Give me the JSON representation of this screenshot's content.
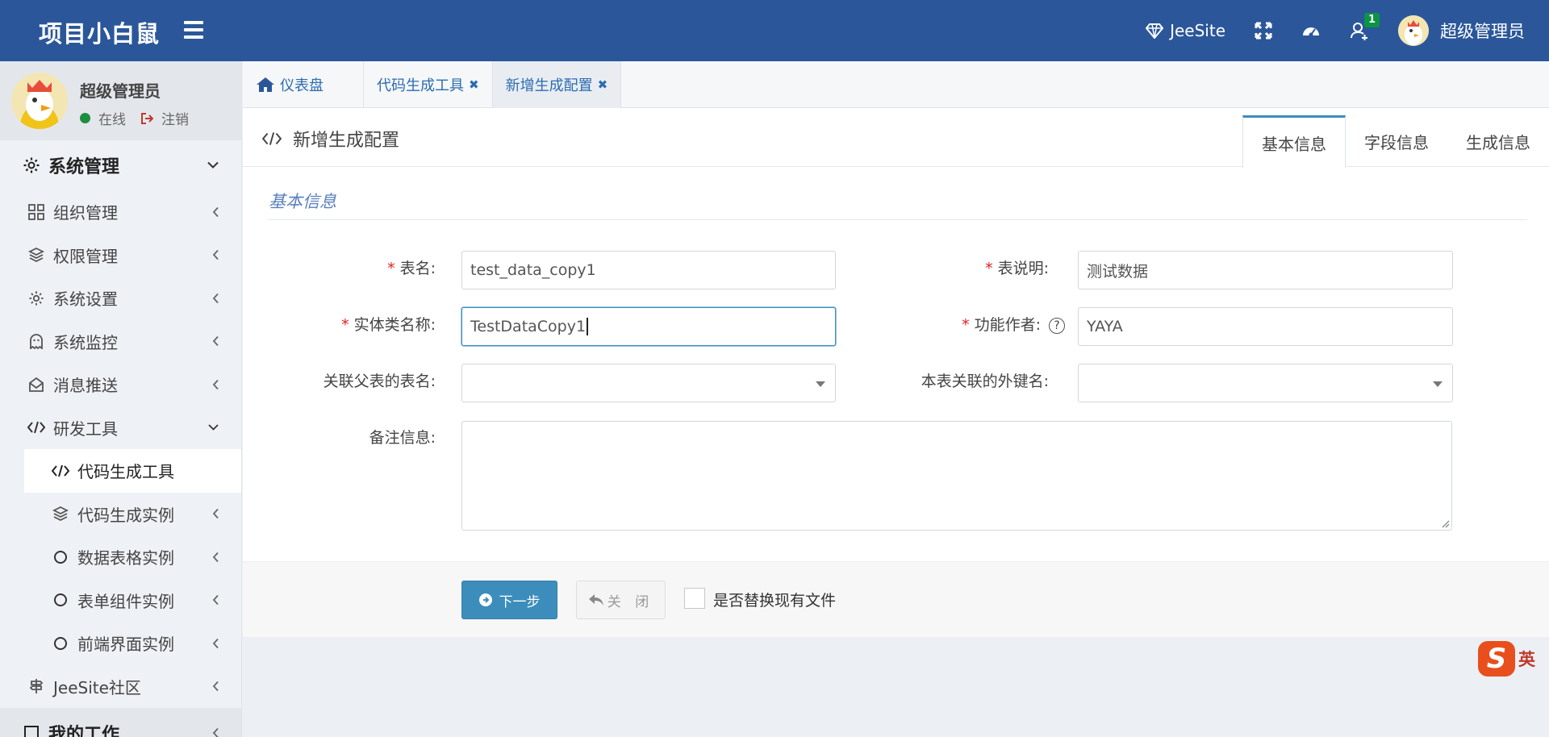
{
  "header": {
    "brand": "项目小白鼠",
    "site_label": "JeeSite",
    "notification_count": "1",
    "user_name": "超级管理员"
  },
  "sidebar": {
    "user_name": "超级管理员",
    "status": "在线",
    "logout": "注销",
    "section": "系统管理",
    "items": [
      {
        "label": "组织管理",
        "icon": "grid-icon"
      },
      {
        "label": "权限管理",
        "icon": "layers-icon"
      },
      {
        "label": "系统设置",
        "icon": "gear-icon"
      },
      {
        "label": "系统监控",
        "icon": "ghost-icon"
      },
      {
        "label": "消息推送",
        "icon": "envelope-open-icon"
      },
      {
        "label": "研发工具",
        "icon": "code-icon"
      },
      {
        "label": "代码生成工具",
        "icon": "code-icon"
      },
      {
        "label": "代码生成实例",
        "icon": "layers-icon"
      },
      {
        "label": "数据表格实例",
        "icon": "circle-icon"
      },
      {
        "label": "表单组件实例",
        "icon": "circle-icon"
      },
      {
        "label": "前端界面实例",
        "icon": "circle-icon"
      },
      {
        "label": "JeeSite社区",
        "icon": "signpost-icon"
      },
      {
        "label": "我的工作",
        "icon": "square-icon"
      }
    ]
  },
  "page_tabs": [
    {
      "label": "仪表盘"
    },
    {
      "label": "代码生成工具"
    },
    {
      "label": "新增生成配置"
    }
  ],
  "main": {
    "title": "新增生成配置",
    "form_tabs": [
      "基本信息",
      "字段信息",
      "生成信息"
    ],
    "legend": "基本信息",
    "fields": {
      "table_name_label": "表名:",
      "table_name_value": "test_data_copy1",
      "table_desc_label": "表说明:",
      "table_desc_value": "测试数据",
      "class_name_label": "实体类名称:",
      "class_name_value": "TestDataCopy1",
      "author_label": "功能作者:",
      "author_value": "YAYA",
      "parent_table_label": "关联父表的表名:",
      "parent_table_value": "",
      "foreign_key_label": "本表关联的外键名:",
      "foreign_key_value": "",
      "remarks_label": "备注信息:",
      "remarks_value": ""
    },
    "buttons": {
      "next": "下一步",
      "close": "关 闭",
      "replace_label": "是否替换现有文件"
    }
  },
  "ime": {
    "label": "英"
  },
  "colors": {
    "header": "#2b579a",
    "primary": "#3c8dbc",
    "required": "#e02020"
  }
}
